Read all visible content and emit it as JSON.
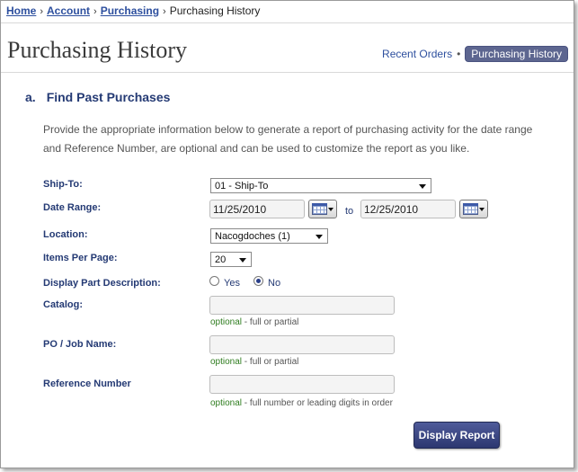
{
  "breadcrumb": {
    "home": "Home",
    "account": "Account",
    "purchasing": "Purchasing",
    "current": "Purchasing History",
    "separator": "›"
  },
  "header": {
    "title": "Purchasing History",
    "nav_recent": "Recent Orders",
    "nav_dot": "•",
    "nav_active": "Purchasing History"
  },
  "section": {
    "number": "a.",
    "title": "Find Past Purchases",
    "desc_line1": "Provide the appropriate information below to generate a report of purchasing activity for the date range",
    "desc_line2": "and Reference Number, are optional and can be used to customize the report as you like."
  },
  "form": {
    "ship_to_label": "Ship-To:",
    "ship_to_value": "01 -  Ship-To",
    "date_range_label": "Date Range:",
    "date_from": "11/25/2010",
    "date_to_word": "to",
    "date_to": "12/25/2010",
    "location_label": "Location:",
    "location_value": "Nacogdoches (1)",
    "items_label": "Items Per Page:",
    "items_value": "20",
    "display_desc_label": "Display Part Description:",
    "radio_yes": "Yes",
    "radio_no": "No",
    "catalog_label": "Catalog:",
    "catalog_value": "",
    "catalog_hint_opt": "optional",
    "catalog_hint_rest": " - full or partial",
    "po_label": "PO / Job Name:",
    "po_value": "",
    "po_hint_opt": "optional",
    "po_hint_rest": " - full or partial",
    "ref_label": "Reference Number",
    "ref_value": "",
    "ref_hint_opt": "optional",
    "ref_hint_rest": " - full number or leading digits in order",
    "submit_label": "Display Report"
  },
  "colors": {
    "link": "#2d4f9e",
    "label": "#243a74",
    "optional": "#2f7d1f",
    "button": "#3a4580"
  }
}
